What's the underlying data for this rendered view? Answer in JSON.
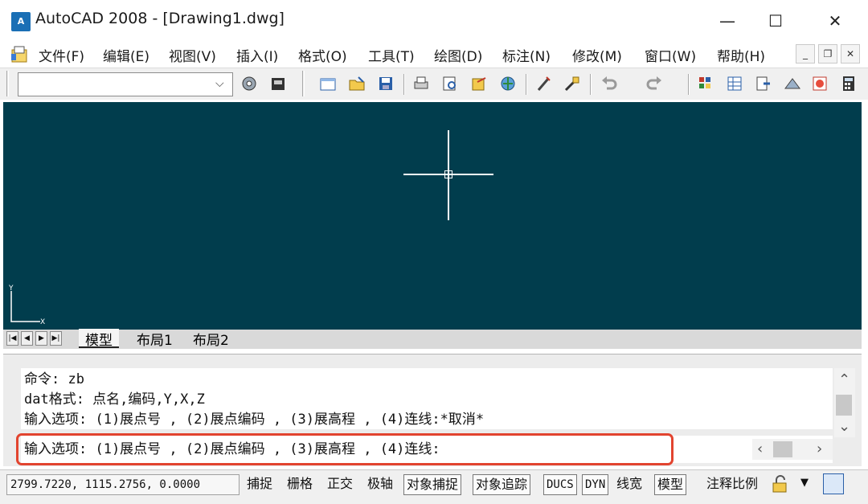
{
  "window": {
    "app_icon_text": "A",
    "title": "AutoCAD 2008 - [Drawing1.dwg]",
    "minimize": "—",
    "maximize": "☐",
    "close": "✕"
  },
  "menu": {
    "items": [
      "文件(F)",
      "编辑(E)",
      "视图(V)",
      "插入(I)",
      "格式(O)",
      "工具(T)",
      "绘图(D)",
      "标注(N)",
      "修改(M)",
      "窗口(W)",
      "帮助(H)"
    ],
    "mdi_minimize": "_",
    "mdi_restore": "❐",
    "mdi_close": "✕"
  },
  "toolbar": {
    "layer_combo_value": "",
    "icons": [
      "workspace-settings-icon",
      "workspace-save-icon",
      "new-icon",
      "open-icon",
      "save-icon",
      "plot-icon",
      "plot-preview-icon",
      "publish-icon",
      "3d-dwf-icon",
      "cut-icon",
      "match-properties-icon",
      "undo-icon",
      "redo-icon",
      "pan-icon",
      "properties-icon",
      "design-center-icon",
      "tool-palettes-icon",
      "markup-icon",
      "calculator-icon"
    ]
  },
  "tabs": {
    "nav_first": "|◀",
    "nav_prev": "◀",
    "nav_next": "▶",
    "nav_last": "▶|",
    "items": [
      "模型",
      "布局1",
      "布局2"
    ]
  },
  "ucs": {
    "y": "Y",
    "x": "X"
  },
  "command": {
    "history": [
      "命令: zb",
      "dat格式:  点名,编码,Y,X,Z",
      "输入选项:  (1)展点号 ,  (2)展点编码 ,  (3)展高程 ,  (4)连线:*取消*"
    ],
    "current": "输入选项:  (1)展点号 ,  (2)展点编码 ,  (3)展高程 ,  (4)连线:"
  },
  "status": {
    "coordinates": "2799.7220, 1115.2756, 0.0000",
    "buttons": [
      "捕捉",
      "栅格",
      "正交",
      "极轴",
      "对象捕捉",
      "对象追踪",
      "DUCS",
      "DYN",
      "线宽",
      "模型"
    ],
    "annotation_scale_label": "注释比例"
  },
  "colors": {
    "drawing_background": "#013d4d",
    "highlight_border": "#e2442f"
  }
}
